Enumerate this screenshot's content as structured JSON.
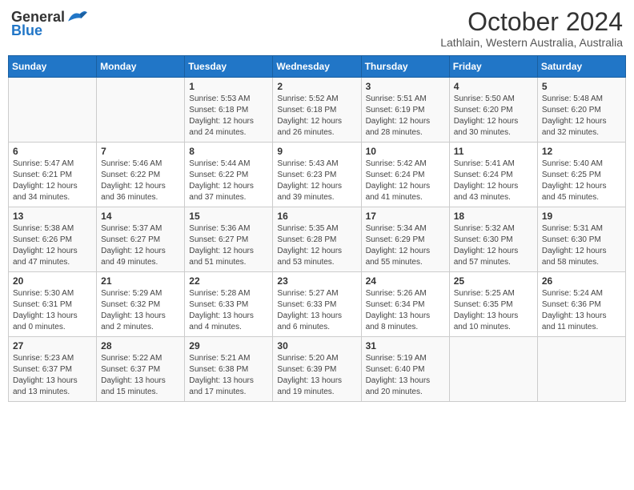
{
  "header": {
    "logo_general": "General",
    "logo_blue": "Blue",
    "month": "October 2024",
    "location": "Lathlain, Western Australia, Australia"
  },
  "days_of_week": [
    "Sunday",
    "Monday",
    "Tuesday",
    "Wednesday",
    "Thursday",
    "Friday",
    "Saturday"
  ],
  "weeks": [
    [
      {
        "day": "",
        "info": ""
      },
      {
        "day": "",
        "info": ""
      },
      {
        "day": "1",
        "info": "Sunrise: 5:53 AM\nSunset: 6:18 PM\nDaylight: 12 hours and 24 minutes."
      },
      {
        "day": "2",
        "info": "Sunrise: 5:52 AM\nSunset: 6:18 PM\nDaylight: 12 hours and 26 minutes."
      },
      {
        "day": "3",
        "info": "Sunrise: 5:51 AM\nSunset: 6:19 PM\nDaylight: 12 hours and 28 minutes."
      },
      {
        "day": "4",
        "info": "Sunrise: 5:50 AM\nSunset: 6:20 PM\nDaylight: 12 hours and 30 minutes."
      },
      {
        "day": "5",
        "info": "Sunrise: 5:48 AM\nSunset: 6:20 PM\nDaylight: 12 hours and 32 minutes."
      }
    ],
    [
      {
        "day": "6",
        "info": "Sunrise: 5:47 AM\nSunset: 6:21 PM\nDaylight: 12 hours and 34 minutes."
      },
      {
        "day": "7",
        "info": "Sunrise: 5:46 AM\nSunset: 6:22 PM\nDaylight: 12 hours and 36 minutes."
      },
      {
        "day": "8",
        "info": "Sunrise: 5:44 AM\nSunset: 6:22 PM\nDaylight: 12 hours and 37 minutes."
      },
      {
        "day": "9",
        "info": "Sunrise: 5:43 AM\nSunset: 6:23 PM\nDaylight: 12 hours and 39 minutes."
      },
      {
        "day": "10",
        "info": "Sunrise: 5:42 AM\nSunset: 6:24 PM\nDaylight: 12 hours and 41 minutes."
      },
      {
        "day": "11",
        "info": "Sunrise: 5:41 AM\nSunset: 6:24 PM\nDaylight: 12 hours and 43 minutes."
      },
      {
        "day": "12",
        "info": "Sunrise: 5:40 AM\nSunset: 6:25 PM\nDaylight: 12 hours and 45 minutes."
      }
    ],
    [
      {
        "day": "13",
        "info": "Sunrise: 5:38 AM\nSunset: 6:26 PM\nDaylight: 12 hours and 47 minutes."
      },
      {
        "day": "14",
        "info": "Sunrise: 5:37 AM\nSunset: 6:27 PM\nDaylight: 12 hours and 49 minutes."
      },
      {
        "day": "15",
        "info": "Sunrise: 5:36 AM\nSunset: 6:27 PM\nDaylight: 12 hours and 51 minutes."
      },
      {
        "day": "16",
        "info": "Sunrise: 5:35 AM\nSunset: 6:28 PM\nDaylight: 12 hours and 53 minutes."
      },
      {
        "day": "17",
        "info": "Sunrise: 5:34 AM\nSunset: 6:29 PM\nDaylight: 12 hours and 55 minutes."
      },
      {
        "day": "18",
        "info": "Sunrise: 5:32 AM\nSunset: 6:30 PM\nDaylight: 12 hours and 57 minutes."
      },
      {
        "day": "19",
        "info": "Sunrise: 5:31 AM\nSunset: 6:30 PM\nDaylight: 12 hours and 58 minutes."
      }
    ],
    [
      {
        "day": "20",
        "info": "Sunrise: 5:30 AM\nSunset: 6:31 PM\nDaylight: 13 hours and 0 minutes."
      },
      {
        "day": "21",
        "info": "Sunrise: 5:29 AM\nSunset: 6:32 PM\nDaylight: 13 hours and 2 minutes."
      },
      {
        "day": "22",
        "info": "Sunrise: 5:28 AM\nSunset: 6:33 PM\nDaylight: 13 hours and 4 minutes."
      },
      {
        "day": "23",
        "info": "Sunrise: 5:27 AM\nSunset: 6:33 PM\nDaylight: 13 hours and 6 minutes."
      },
      {
        "day": "24",
        "info": "Sunrise: 5:26 AM\nSunset: 6:34 PM\nDaylight: 13 hours and 8 minutes."
      },
      {
        "day": "25",
        "info": "Sunrise: 5:25 AM\nSunset: 6:35 PM\nDaylight: 13 hours and 10 minutes."
      },
      {
        "day": "26",
        "info": "Sunrise: 5:24 AM\nSunset: 6:36 PM\nDaylight: 13 hours and 11 minutes."
      }
    ],
    [
      {
        "day": "27",
        "info": "Sunrise: 5:23 AM\nSunset: 6:37 PM\nDaylight: 13 hours and 13 minutes."
      },
      {
        "day": "28",
        "info": "Sunrise: 5:22 AM\nSunset: 6:37 PM\nDaylight: 13 hours and 15 minutes."
      },
      {
        "day": "29",
        "info": "Sunrise: 5:21 AM\nSunset: 6:38 PM\nDaylight: 13 hours and 17 minutes."
      },
      {
        "day": "30",
        "info": "Sunrise: 5:20 AM\nSunset: 6:39 PM\nDaylight: 13 hours and 19 minutes."
      },
      {
        "day": "31",
        "info": "Sunrise: 5:19 AM\nSunset: 6:40 PM\nDaylight: 13 hours and 20 minutes."
      },
      {
        "day": "",
        "info": ""
      },
      {
        "day": "",
        "info": ""
      }
    ]
  ]
}
